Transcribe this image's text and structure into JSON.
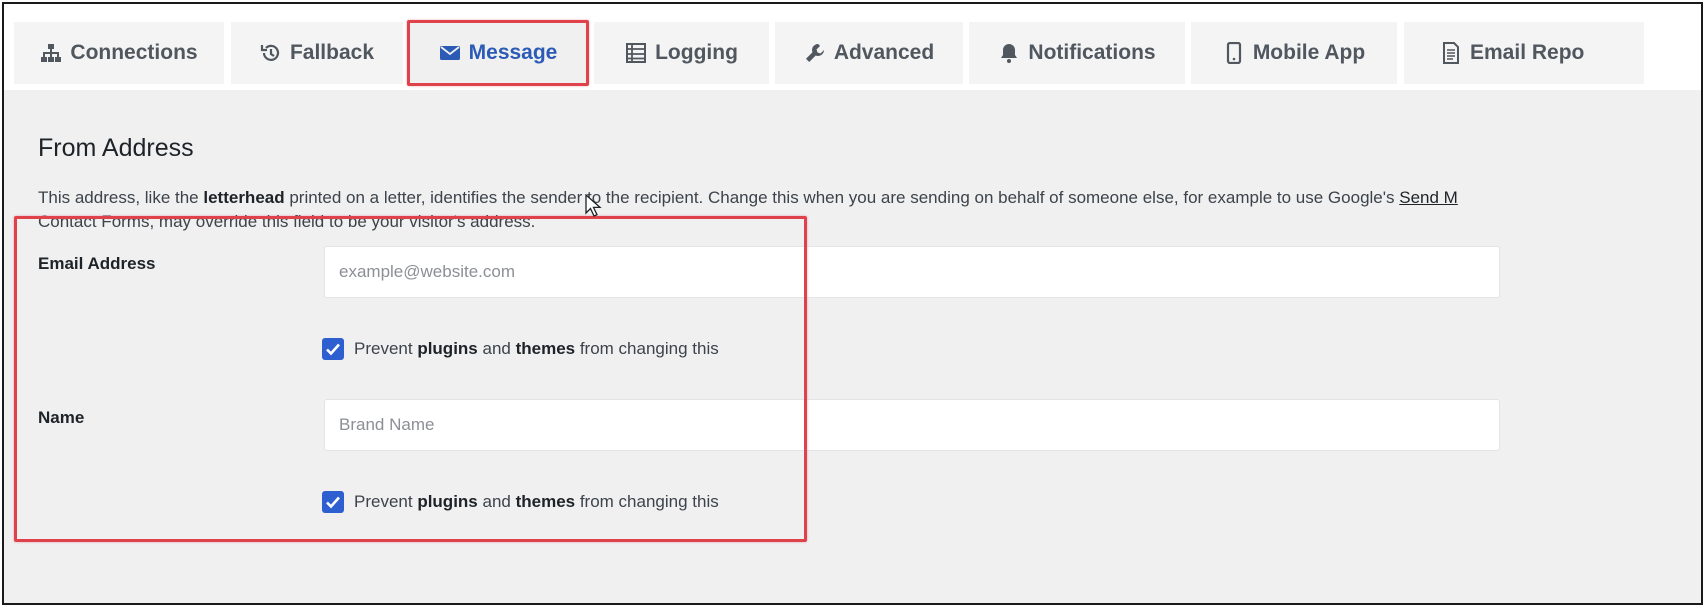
{
  "tabs": [
    {
      "label": "Connections",
      "icon": "sitemap-icon"
    },
    {
      "label": "Fallback",
      "icon": "history-icon"
    },
    {
      "label": "Message",
      "icon": "envelope-icon",
      "active": true
    },
    {
      "label": "Logging",
      "icon": "list-icon"
    },
    {
      "label": "Advanced",
      "icon": "wrench-icon"
    },
    {
      "label": "Notifications",
      "icon": "bell-icon"
    },
    {
      "label": "Mobile App",
      "icon": "mobile-icon"
    },
    {
      "label": "Email Repo",
      "icon": "document-icon"
    }
  ],
  "section": {
    "title": "From Address",
    "desc_part1": "This address, like the ",
    "desc_bold": "letterhead",
    "desc_part2": " printed on a letter, identifies the sender to the recipient. Change this when you are sending on behalf of someone else, for example to use Google's ",
    "desc_link": "Send M",
    "desc_line2": "Contact Forms, may override this field to be your visitor's address."
  },
  "email_field": {
    "label": "Email Address",
    "placeholder": "example@website.com",
    "value": ""
  },
  "name_field": {
    "label": "Name",
    "placeholder": "Brand Name",
    "value": ""
  },
  "prevent_check": {
    "prefix": "Prevent ",
    "bold1": "plugins",
    "mid": " and ",
    "bold2": "themes",
    "suffix": " from changing this",
    "checked": true
  },
  "colors": {
    "accent": "#2e5fd1",
    "active_tab_text": "#2b5bb5",
    "highlight": "#e0424b"
  }
}
